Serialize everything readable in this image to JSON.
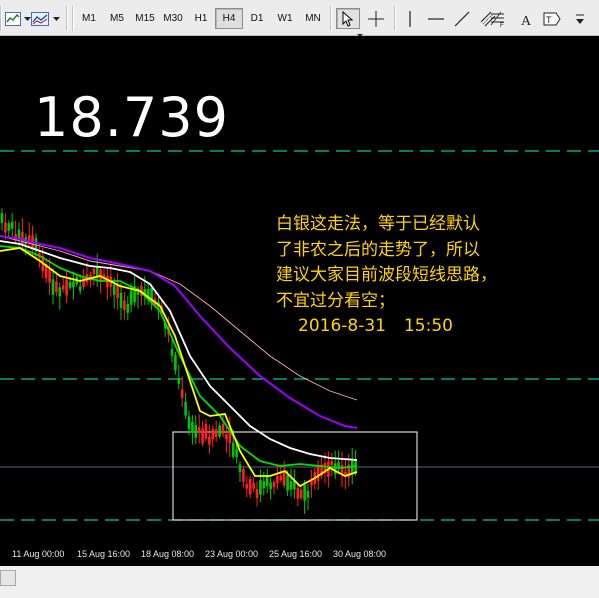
{
  "toolbar": {
    "timeframes": [
      "M1",
      "M5",
      "M15",
      "M30",
      "H1",
      "H4",
      "D1",
      "W1",
      "MN"
    ],
    "active_timeframe": "H4",
    "tools": [
      "chart-properties-icon",
      "line-studies-icon",
      "cursor-icon",
      "crosshair-icon",
      "vertical-line-icon",
      "horizontal-line-icon",
      "trendline-icon",
      "channel-icon",
      "fibonacci-icon",
      "text-icon",
      "label-icon"
    ]
  },
  "chart": {
    "price": "18.739",
    "annotation_lines": [
      "白银这走法，等于已经默认",
      "了非农之后的走势了，所以",
      "建议大家目前波段短线思路，",
      "不宜过分看空；"
    ],
    "annotation_date": "2016-8-31",
    "annotation_time": "15:50",
    "dates": [
      "11 Aug 00:00",
      "15 Aug 16:00",
      "18 Aug 08:00",
      "23 Aug 00:00",
      "25 Aug 16:00",
      "30 Aug 08:00"
    ],
    "colors": {
      "background": "#000000",
      "bull_candle": "#00c800",
      "bear_candle": "#ff2020",
      "ma_white": "#ffffff",
      "ma_yellow": "#ffff00",
      "ma_green": "#00e000",
      "ma_purple": "#a000ff",
      "ma_pink": "#ffb0b0",
      "annotation": "#ffd400",
      "dashed_level": "#00c8a0"
    }
  }
}
